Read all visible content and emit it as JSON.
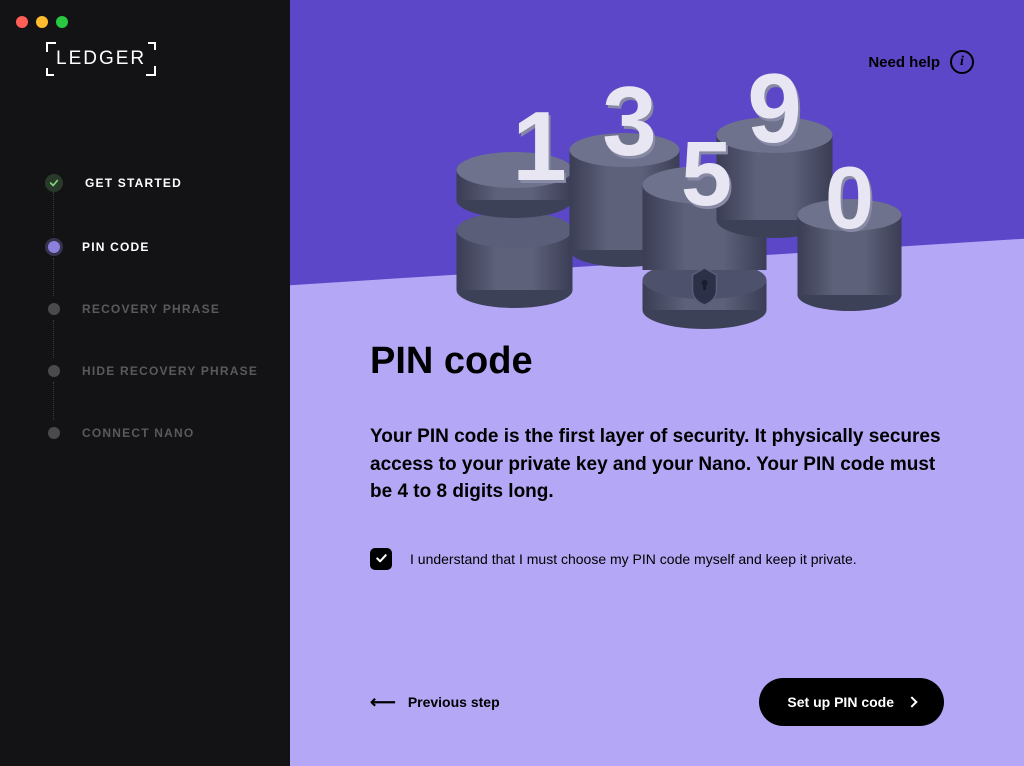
{
  "app": {
    "name": "LEDGER"
  },
  "help": {
    "label": "Need help"
  },
  "steps": [
    {
      "label": "GET STARTED",
      "state": "completed"
    },
    {
      "label": "PIN CODE",
      "state": "active"
    },
    {
      "label": "RECOVERY PHRASE",
      "state": "pending"
    },
    {
      "label": "HIDE RECOVERY PHRASE",
      "state": "pending"
    },
    {
      "label": "CONNECT NANO",
      "state": "pending"
    }
  ],
  "content": {
    "title": "PIN code",
    "description": "Your PIN code is the first layer of security. It physically secures access to your private key and your Nano. Your PIN code must be 4 to 8 digits long.",
    "checkbox_label": "I understand that I must choose my PIN code myself and keep it private.",
    "checkbox_checked": true
  },
  "illustration": {
    "digits": [
      "1",
      "3",
      "9",
      "5",
      "0"
    ]
  },
  "nav": {
    "previous": "Previous step",
    "next": "Set up PIN code"
  }
}
